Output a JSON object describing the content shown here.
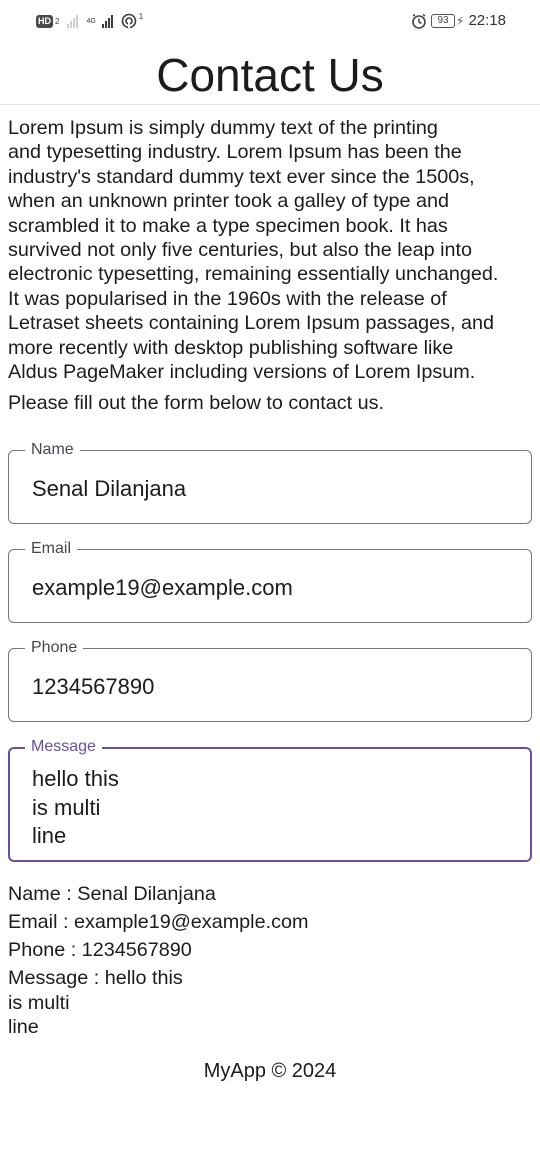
{
  "status_bar": {
    "hd_label": "HD",
    "hd_sub": "2",
    "network_type": "4G",
    "notification_count": "1",
    "battery": "93",
    "time": "22:18",
    "icons": [
      "signal-bars-icon",
      "sync-icon",
      "alarm-icon",
      "battery-icon",
      "charging-bolt-icon"
    ]
  },
  "header": {
    "title": "Contact Us"
  },
  "intro": " Lorem Ipsum is simply dummy text of the printing\nand typesetting industry. Lorem Ipsum has been the\nindustry's standard dummy text ever since the 1500s,\nwhen an unknown printer took a galley of type and\nscrambled it to make a type specimen book. It has\nsurvived not only five centuries, but also the leap into\nelectronic typesetting, remaining essentially unchanged.\nIt was popularised in the 1960s with the release of\nLetraset sheets containing Lorem Ipsum passages, and\nmore recently with desktop publishing software like\nAldus PageMaker including versions of Lorem Ipsum.",
  "instruction": "Please fill out the form below to contact us.",
  "form": {
    "name": {
      "label": "Name",
      "value": "Senal Dilanjana"
    },
    "email": {
      "label": "Email",
      "value": "example19@example.com"
    },
    "phone": {
      "label": "Phone",
      "value": "1234567890"
    },
    "message": {
      "label": "Message",
      "value": "hello this\nis multi\nline"
    }
  },
  "summary": {
    "name_line": "Name : Senal Dilanjana",
    "email_line": "Email : example19@example.com",
    "phone_line": "Phone : 1234567890",
    "message_line": "Message : hello this\nis multi\nline"
  },
  "footer": "MyApp © 2024",
  "colors": {
    "accent": "#6750a4",
    "outline": "#79747e",
    "text": "#1c1b1f"
  }
}
